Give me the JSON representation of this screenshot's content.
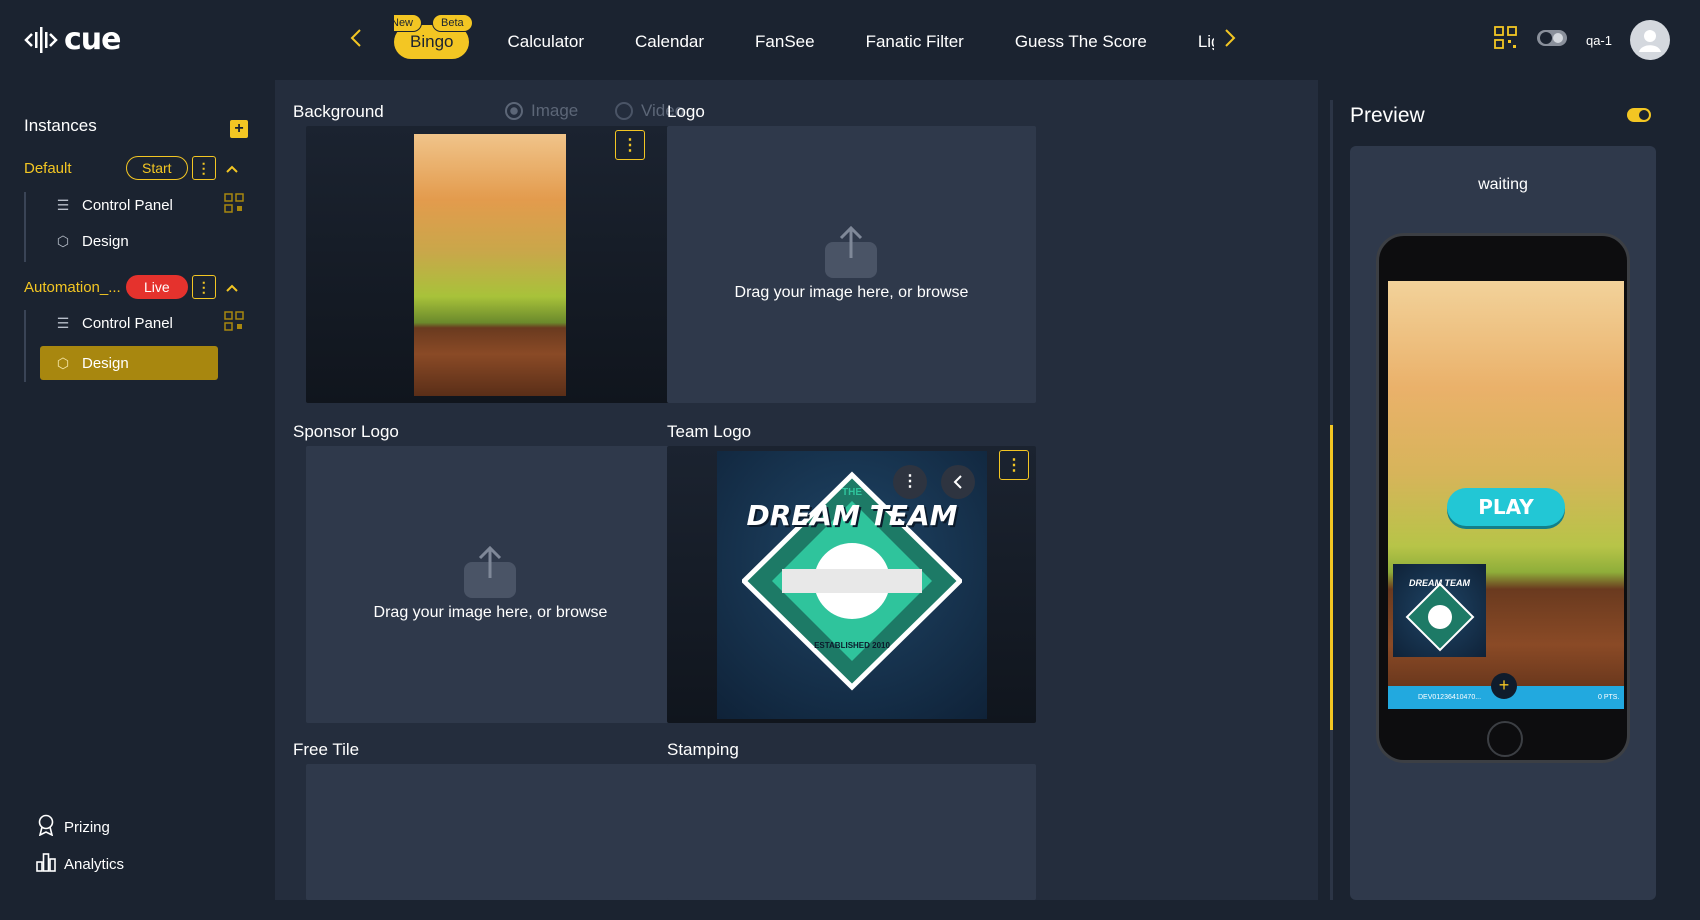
{
  "app": {
    "logo_text": "cue"
  },
  "header": {
    "tabs": [
      {
        "label": "Bingo",
        "badges": [
          "New",
          "Beta"
        ],
        "active": true
      },
      {
        "label": "Calculator"
      },
      {
        "label": "Calendar"
      },
      {
        "label": "FanSee"
      },
      {
        "label": "Fanatic Filter"
      },
      {
        "label": "Guess The Score"
      },
      {
        "label": "Lig"
      }
    ],
    "user_name": "qa-1"
  },
  "sidebar": {
    "title": "Instances",
    "instances": [
      {
        "name": "Default",
        "action": "Start",
        "items": [
          {
            "label": "Control Panel",
            "icon": "sliders-icon"
          },
          {
            "label": "Design",
            "icon": "cube-icon"
          }
        ]
      },
      {
        "name": "Automation_...",
        "action": "Live",
        "items": [
          {
            "label": "Control Panel",
            "icon": "sliders-icon"
          },
          {
            "label": "Design",
            "icon": "cube-icon",
            "active": true
          }
        ]
      }
    ],
    "bottom": [
      {
        "label": "Prizing",
        "icon": "award-icon"
      },
      {
        "label": "Analytics",
        "icon": "bar-chart-icon"
      }
    ]
  },
  "main": {
    "background_label": "Background",
    "radio_image": "Image",
    "radio_video": "Video",
    "logo_label": "Logo",
    "drop_text": "Drag your image here, or browse",
    "sponsor_label": "Sponsor Logo",
    "team_label": "Team Logo",
    "free_tile_label": "Free Tile",
    "stamping_label": "Stamping",
    "team_logo": {
      "line1": "THE",
      "line2": "DREAM TEAM",
      "line3": "ESTABLISHED 2010"
    }
  },
  "preview": {
    "title": "Preview",
    "status": "waiting",
    "play_label": "PLAY",
    "footer_user": "DEV01236410470...",
    "footer_points": "0 PTS.",
    "mini_logo_text": "DREAM TEAM"
  },
  "colors": {
    "accent": "#f3c623",
    "live": "#e5322d",
    "play": "#22c7d5"
  }
}
